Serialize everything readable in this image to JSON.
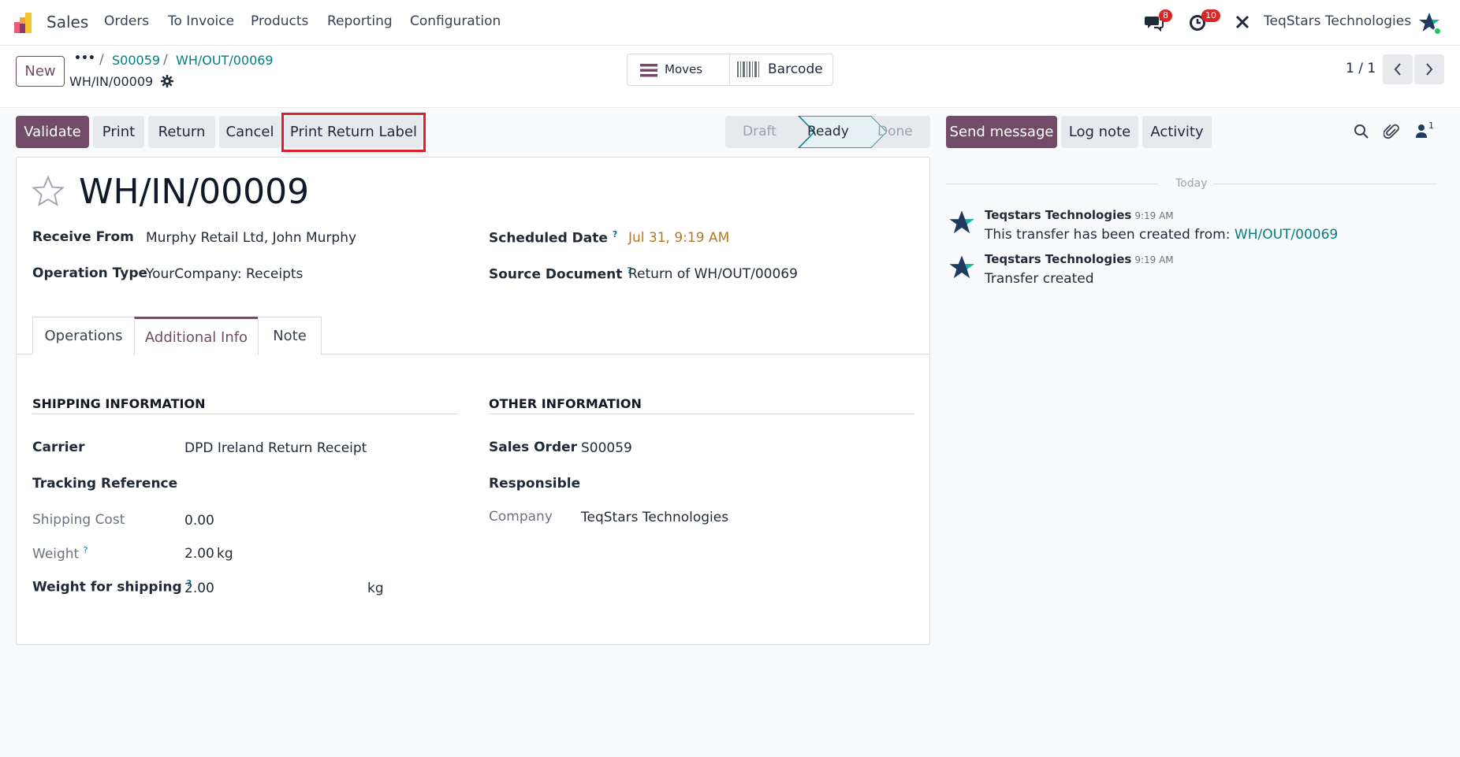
{
  "topnav": {
    "app": "Sales",
    "menu": [
      "Orders",
      "To Invoice",
      "Products",
      "Reporting",
      "Configuration"
    ],
    "messages_count": "8",
    "activities_count": "10",
    "company": "TeqStars Technologies"
  },
  "control": {
    "new_label": "New",
    "more_label": "•••",
    "breadcrumb": [
      "S00059",
      "WH/OUT/00069"
    ],
    "current_record": "WH/IN/00009",
    "moves_label": "Moves",
    "barcode_label": "Barcode",
    "pager": "1 / 1"
  },
  "actions": {
    "validate": "Validate",
    "print": "Print",
    "return": "Return",
    "cancel": "Cancel",
    "print_return_label": "Print Return Label"
  },
  "statusbar": {
    "steps": [
      "Draft",
      "Ready",
      "Done"
    ],
    "active": "Ready"
  },
  "chatter_actions": {
    "send_message": "Send message",
    "log_note": "Log note",
    "activity": "Activity",
    "followers_count": "1"
  },
  "form": {
    "title": "WH/IN/00009",
    "receive_from_label": "Receive From",
    "receive_from": "Murphy Retail Ltd, John Murphy",
    "operation_type_label": "Operation Type",
    "operation_type": "YourCompany: Receipts",
    "scheduled_date_label": "Scheduled Date",
    "scheduled_date": "Jul 31, 9:19 AM",
    "source_document_label": "Source Document",
    "source_document": "Return of WH/OUT/00069",
    "help_mark": "?",
    "tabs": [
      "Operations",
      "Additional Info",
      "Note"
    ],
    "active_tab": "Additional Info"
  },
  "shipping": {
    "heading": "SHIPPING INFORMATION",
    "carrier_label": "Carrier",
    "carrier": "DPD Ireland Return Receipt",
    "tracking_label": "Tracking Reference",
    "cost_label": "Shipping Cost",
    "cost": "0.00",
    "weight_label": "Weight",
    "weight": "2.00",
    "weight_unit": "kg",
    "weight_shipping_label": "Weight for shipping",
    "weight_shipping": "2.00",
    "weight_shipping_unit": "kg"
  },
  "other": {
    "heading": "OTHER INFORMATION",
    "sales_order_label": "Sales Order",
    "sales_order": "S00059",
    "responsible_label": "Responsible",
    "company_label": "Company",
    "company": "TeqStars Technologies"
  },
  "chatter": {
    "day_separator": "Today",
    "messages": [
      {
        "author": "Teqstars Technologies",
        "time": "9:19 AM",
        "text": "This transfer has been created from:",
        "link": "WH/OUT/00069"
      },
      {
        "author": "Teqstars Technologies",
        "time": "9:19 AM",
        "text": "Transfer created"
      }
    ]
  },
  "colors": {
    "brand": "#714b67",
    "link": "#017e84",
    "date": "#b7791f",
    "highlight": "#e11d2a"
  }
}
